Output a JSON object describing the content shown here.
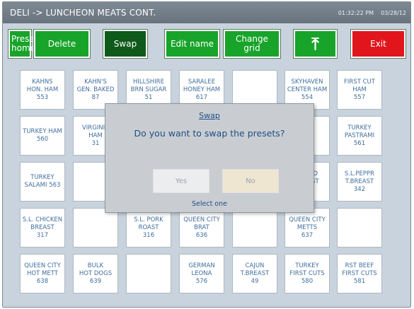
{
  "window": {
    "title": "DELI -> LUNCHEON MEATS CONT.",
    "time": "01:32:22 PM",
    "date": "03/28/12"
  },
  "toolbar": {
    "preset_home_label": "Preset\nhome",
    "delete_label": "Delete",
    "swap_label": "Swap",
    "edit_name_label": "Edit name",
    "change_grid_label": "Change\ngrid",
    "up_icon": "up-arrow-icon",
    "exit_label": "Exit",
    "colors": {
      "green": "#18a42a",
      "dark_green": "#0d5a1a",
      "red": "#e0161c"
    }
  },
  "grid": {
    "rows": [
      [
        "KAHNS\nHON. HAM\n553",
        "KAHN'S\nGEN. BAKED\n87",
        "HILLSHIRE\nBRN SUGAR\n51",
        "SARALEE\nHONEY HAM\n617",
        "",
        "SKYHAVEN\nCENTER HAM\n554",
        "FIRST CUT\nHAM\n557"
      ],
      [
        "TURKEY HAM\n560",
        "VIRGINIA\nHAM\n31",
        "",
        "",
        "",
        "",
        "TURKEY\nPASTRAMI\n561"
      ],
      [
        "TURKEY\nSALAMI 563",
        "",
        "",
        "",
        "",
        "SMKED\nBREAST\n547",
        "S.L.PEPPR\nT.BREAST\n342"
      ],
      [
        "S.L. CHICKEN\nBREAST\n317",
        "",
        "S.L. PORK\nROAST\n316",
        "QUEEN CITY\nBRAT\n636",
        "",
        "QUEEN CITY\nMETTS\n637",
        ""
      ],
      [
        "QUEEN CITY\nHOT METT\n638",
        "BULK\nHOT DOGS\n639",
        "",
        "GERMAN\nLEONA\n576",
        "CAJUN\nT.BREAST\n49",
        "TURKEY\nFIRST CUTS\n580",
        "RST BEEF\nFIRST CUTS\n581"
      ]
    ]
  },
  "dialog": {
    "title": "Swap",
    "question": "Do you want to swap the presets?",
    "yes_label": "Yes",
    "no_label": "No",
    "hint": "Select one"
  }
}
